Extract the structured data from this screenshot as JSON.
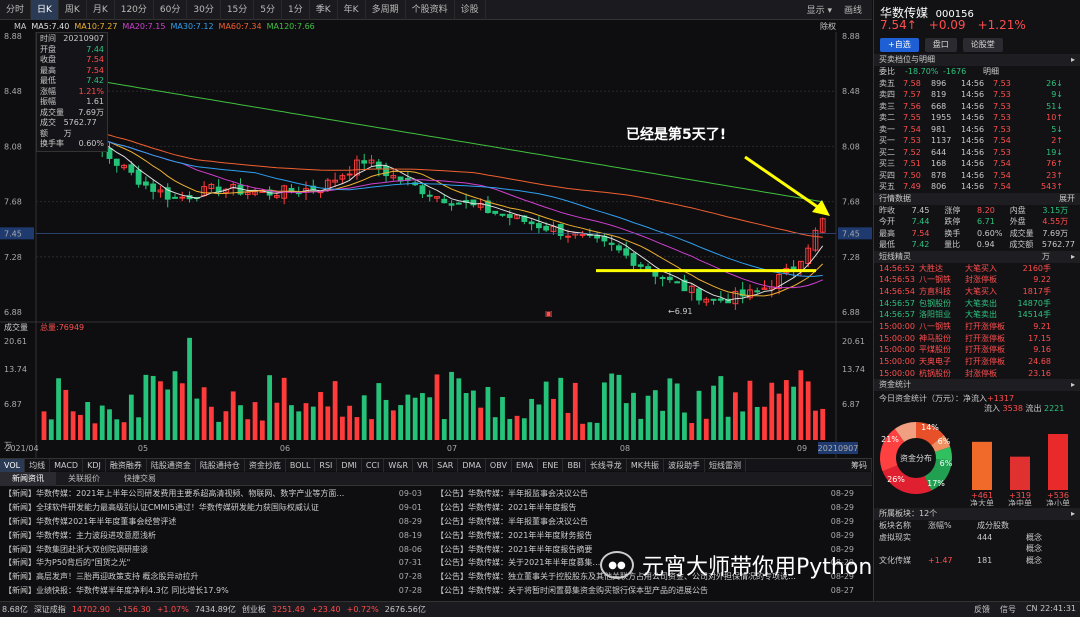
{
  "toolbar": {
    "items": [
      "分时",
      "日K",
      "周K",
      "月K",
      "120分",
      "60分",
      "30分",
      "15分",
      "5分",
      "1分",
      "季K",
      "年K",
      "多周期",
      "个股资料",
      "诊股"
    ],
    "active": 1,
    "right": [
      "显示 ▾",
      "画线"
    ]
  },
  "ma_legend": [
    {
      "label": "MA",
      "color": "#ccc"
    },
    {
      "label": "MA5:7.40",
      "color": "#e0e0e0"
    },
    {
      "label": "MA10:7.27",
      "color": "#f0b030"
    },
    {
      "label": "MA20:7.15",
      "color": "#d040d0"
    },
    {
      "label": "MA30:7.12",
      "color": "#30a0f0"
    },
    {
      "label": "MA60:7.34",
      "color": "#f06030"
    },
    {
      "label": "MA120:7.66",
      "color": "#40c040"
    }
  ],
  "chart_right_label": "除权",
  "infobox": [
    [
      "时间",
      "20210907"
    ],
    [
      "开盘",
      "7.44"
    ],
    [
      "收盘",
      "7.54"
    ],
    [
      "最高",
      "7.54"
    ],
    [
      "最低",
      "7.42"
    ],
    [
      "涨幅",
      "1.21%"
    ],
    [
      "振幅",
      "1.61"
    ],
    [
      "成交量",
      "7.69万"
    ],
    [
      "成交额",
      "5762.77万"
    ],
    [
      "换手率",
      "0.60%"
    ]
  ],
  "price_axis": [
    "8.88",
    "8.48",
    "8.08",
    "7.68",
    "7.45",
    "7.28",
    "6.88"
  ],
  "vol_axis": [
    "20.61",
    "13.74",
    "6.87",
    "万"
  ],
  "date_axis": [
    "2021/04",
    "05",
    "06",
    "07",
    "08",
    "09",
    "20210907"
  ],
  "vol_label": "成交量",
  "vol_value": "总量:76949",
  "low_label": "6.91",
  "annotation": "已经是第5天了!",
  "ind_tabs": [
    "VOL",
    "均线",
    "MACD",
    "KDJ",
    "融资融券",
    "陆股通资金",
    "陆股通持仓",
    "资金抄底",
    "BOLL",
    "RSI",
    "DMI",
    "CCI",
    "W&R",
    "VR",
    "SAR",
    "DMA",
    "OBV",
    "EMA",
    "ENE",
    "BBI",
    "长线寻龙",
    "MK共振",
    "波段助手",
    "短线雷测"
  ],
  "ind_active": 0,
  "ind_right": "筹码",
  "news_tabs": [
    "新闻资讯",
    "关联报价",
    "快捷交易"
  ],
  "news_left": [
    [
      "【新闻】华数传媒：2021年上半年公司研发费用主要系超高清视频、物联网、数字产业等方面…",
      "09-03"
    ],
    [
      "【新闻】全球软件研发能力最高级别认证CMMI5通过！华数传媒研发能力获国际权威认证",
      "09-01"
    ],
    [
      "【新闻】华数传媒2021年半年度董事会经营评述",
      "08-29"
    ],
    [
      "【新闻】华数传媒：主力波段进攻意愿浅析",
      "08-19"
    ],
    [
      "【新闻】华数集团赴浙大双创院调研座谈",
      "08-06"
    ],
    [
      "【新闻】华为P50背后的\"国货之光\"",
      "07-31"
    ],
    [
      "【新闻】高层发声！三胎再迎政策支持 概念股异动拉升",
      "07-28"
    ],
    [
      "【新闻】业绩快报：华数传媒半年度净利4.3亿 同比增长17.9%",
      "07-28"
    ]
  ],
  "news_right": [
    [
      "【公告】华数传媒：半年报监事会决议公告",
      "08-29"
    ],
    [
      "【公告】华数传媒：2021年半年度报告",
      "08-29"
    ],
    [
      "【公告】华数传媒：半年报董事会决议公告",
      "08-29"
    ],
    [
      "【公告】华数传媒：2021年半年度财务报告",
      "08-29"
    ],
    [
      "【公告】华数传媒：2021年半年度报告摘要",
      "08-29"
    ],
    [
      "【公告】华数传媒：关于2021年半年度募集…",
      "08-29"
    ],
    [
      "【公告】华数传媒：独立董事关于控股股东及其他关联方占用公司资金、公司对外担保情况的专项说…",
      "08-29"
    ],
    [
      "【公告】华数传媒：关于将暂时闲置募集资金购买银行保本型产品的进展公告",
      "08-27"
    ]
  ],
  "watermark": "元宵大师带你用Python量化交易",
  "watermark_icon": "wechat-icon",
  "status": {
    "items": [
      {
        "t": "8.68亿",
        "c": ""
      },
      {
        "t": "深证成指",
        "c": ""
      },
      {
        "t": "14702.90",
        "c": "up"
      },
      {
        "t": "+156.30",
        "c": "up"
      },
      {
        "t": "+1.07%",
        "c": "up"
      },
      {
        "t": "7434.89亿",
        "c": ""
      },
      {
        "t": "创业板",
        "c": ""
      },
      {
        "t": "3251.49",
        "c": "up"
      },
      {
        "t": "+23.40",
        "c": "up"
      },
      {
        "t": "+0.72%",
        "c": "up"
      },
      {
        "t": "2676.56亿",
        "c": ""
      }
    ],
    "right": [
      "反馈",
      "信号",
      "CN 22:41:31"
    ]
  },
  "stock": {
    "name": "华数传媒",
    "code": "000156",
    "price": "7.54",
    "arrow": "↑",
    "chg": "+0.09",
    "pct": "+1.21%"
  },
  "rbtns": [
    "+自选",
    "盘口",
    "论股堂"
  ],
  "orderbook_title": "买卖档位与明细",
  "webi": [
    "委比",
    "-18.70%",
    "-1676",
    "明细"
  ],
  "orders": [
    [
      "卖五",
      "7.58",
      "896",
      "14:56",
      "7.53",
      "26↓"
    ],
    [
      "卖四",
      "7.57",
      "819",
      "14:56",
      "7.53",
      "9↓"
    ],
    [
      "卖三",
      "7.56",
      "668",
      "14:56",
      "7.53",
      "51↓"
    ],
    [
      "卖二",
      "7.55",
      "1955",
      "14:56",
      "7.53",
      "10↑"
    ],
    [
      "卖一",
      "7.54",
      "981",
      "14:56",
      "7.53",
      "5↓"
    ],
    [
      "买一",
      "7.53",
      "1137",
      "14:56",
      "7.54",
      "2↑"
    ],
    [
      "买二",
      "7.52",
      "644",
      "14:56",
      "7.53",
      "19↓"
    ],
    [
      "买三",
      "7.51",
      "168",
      "14:56",
      "7.54",
      "76↑"
    ],
    [
      "买四",
      "7.50",
      "878",
      "14:56",
      "7.54",
      "23↑"
    ],
    [
      "买五",
      "7.49",
      "806",
      "14:56",
      "7.54",
      "543↑"
    ]
  ],
  "quote_title": "行情数据",
  "quote_more": "展开",
  "quotes": [
    [
      "昨收",
      "7.45",
      "涨停",
      "8.20",
      "内盘",
      "3.15万"
    ],
    [
      "今开",
      "7.44",
      "跌停",
      "6.71",
      "外盘",
      "4.55万"
    ],
    [
      "最高",
      "7.54",
      "换手",
      "0.60%",
      "成交量",
      "7.69万"
    ],
    [
      "最低",
      "7.42",
      "量比",
      "0.94",
      "成交额",
      "5762.77万"
    ]
  ],
  "ticks_title": "短线精灵",
  "ticks": [
    [
      "14:56:52",
      "大胜达",
      "大笔买入",
      "2160手",
      "r"
    ],
    [
      "14:56:53",
      "八一钢铁",
      "封涨停板",
      "9.22",
      "r"
    ],
    [
      "14:56:54",
      "方直科技",
      "大笔买入",
      "1817手",
      "r"
    ],
    [
      "14:56:57",
      "包钢股份",
      "大笔卖出",
      "14870手",
      "g"
    ],
    [
      "14:56:57",
      "洛阳钼业",
      "大笔卖出",
      "14514手",
      "g"
    ],
    [
      "15:00:00",
      "八一钢铁",
      "打开涨停板",
      "9.21",
      "r"
    ],
    [
      "15:00:00",
      "神马股份",
      "打开涨停板",
      "17.15",
      "r"
    ],
    [
      "15:00:00",
      "平煤股份",
      "打开涨停板",
      "9.16",
      "r"
    ],
    [
      "15:00:00",
      "天奥电子",
      "打开涨停板",
      "24.68",
      "r"
    ],
    [
      "15:00:00",
      "杭锅股份",
      "封涨停板",
      "23.16",
      "r"
    ]
  ],
  "fund_title": "资金统计",
  "fund_today": "今日资金统计（万元）：净流入",
  "fund_net": "+1317",
  "fund_in_label": "流入",
  "fund_in": "3538",
  "fund_out_label": "流出",
  "fund_out": "2221",
  "fund_center": "资金分布",
  "pie": [
    {
      "v": 14,
      "c": "#e8502a"
    },
    {
      "v": 6,
      "c": "#f09060"
    },
    {
      "v": 6,
      "c": "#30c060"
    },
    {
      "v": 17,
      "c": "#20a050"
    },
    {
      "v": 26,
      "c": "#e02030"
    },
    {
      "v": 21,
      "c": "#ff4040"
    },
    {
      "v": 10,
      "c": "#f0a080"
    }
  ],
  "pie_labels": [
    "14%",
    "6%",
    "6%",
    "17%",
    "26%",
    "21%"
  ],
  "fund_bars": [
    {
      "label": "净大单",
      "val": "+461",
      "v": 461,
      "c": "#f26a2a"
    },
    {
      "label": "净中单",
      "val": "+319",
      "v": 319,
      "c": "#e03030"
    },
    {
      "label": "净小单",
      "val": "+536",
      "v": 536,
      "c": "#e82a2a"
    }
  ],
  "sector_title": "所属板块：12个",
  "sector_head": [
    "板块名称",
    "涨幅%",
    "成分股数"
  ],
  "sectors": [
    [
      "虚拟现实",
      "",
      "444",
      "概念"
    ],
    [
      "",
      "",
      "",
      "概念"
    ],
    [
      "文化传媒",
      "+1.47",
      "181",
      "概念"
    ]
  ],
  "chart_data": {
    "type": "candlestick",
    "ylim": [
      6.88,
      8.88
    ],
    "highlight_low": 6.91,
    "last_close": 7.45
  }
}
